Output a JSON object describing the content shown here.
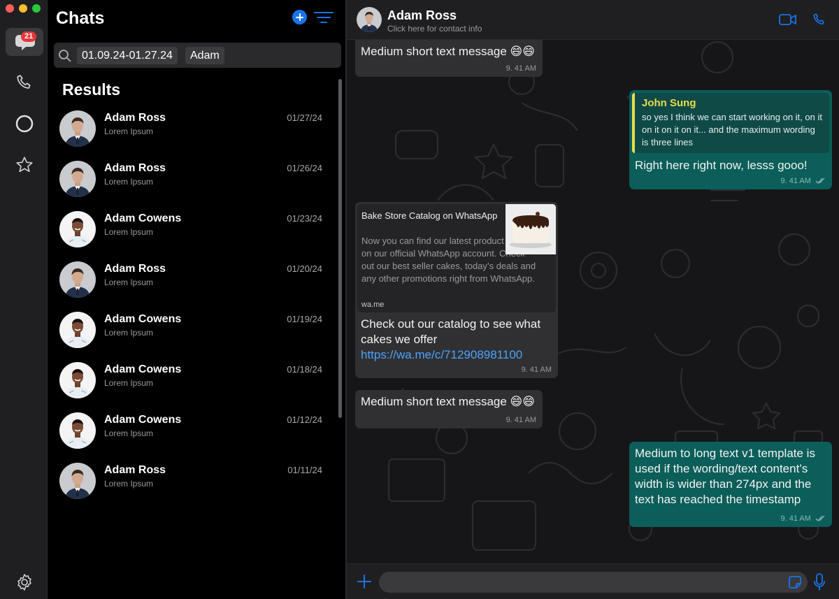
{
  "rail": {
    "chats_badge": "21"
  },
  "list": {
    "title": "Chats",
    "search_chips": [
      "01.09.24-01.27.24",
      "Adam"
    ],
    "results_title": "Results",
    "rows": [
      {
        "name": "Adam Ross",
        "preview": "Lorem Ipsum",
        "date": "01/27/24",
        "avatar": "ross"
      },
      {
        "name": "Adam Ross",
        "preview": "Lorem Ipsum",
        "date": "01/26/24",
        "avatar": "ross"
      },
      {
        "name": "Adam Cowens",
        "preview": "Lorem Ipsum",
        "date": "01/23/24",
        "avatar": "cowens"
      },
      {
        "name": "Adam Ross",
        "preview": "Lorem Ipsum",
        "date": "01/20/24",
        "avatar": "ross"
      },
      {
        "name": "Adam Cowens",
        "preview": "Lorem Ipsum",
        "date": "01/19/24",
        "avatar": "cowens"
      },
      {
        "name": "Adam Cowens",
        "preview": "Lorem Ipsum",
        "date": "01/18/24",
        "avatar": "cowens"
      },
      {
        "name": "Adam Cowens",
        "preview": "Lorem Ipsum",
        "date": "01/12/24",
        "avatar": "cowens"
      },
      {
        "name": "Adam Ross",
        "preview": "Lorem Ipsum",
        "date": "01/11/24",
        "avatar": "ross"
      }
    ]
  },
  "conversation": {
    "contact_name": "Adam Ross",
    "contact_sub": "Click here for contact info",
    "messages": {
      "m1": {
        "text": "Medium short text message 😄😄",
        "time": "9. 41 AM"
      },
      "m2": {
        "quote_author": "John Sung",
        "quote_text": "so yes I think we can start working on it, on it on it on it on it... and the maximum wording is three lines",
        "text": "Right here right now, lesss gooo!",
        "time": "9. 41 AM"
      },
      "m3": {
        "preview_title": "Bake Store Catalog on WhatsApp",
        "preview_desc": "Now you can find our latest product catalog on our official WhatsApp account. Check out our best seller cakes, today’s deals and any other promotions right from WhatsApp.",
        "preview_url": "wa.me",
        "text": "Check out our catalog to see what cakes we offer",
        "link": "https://wa.me/c/712908981100",
        "time": "9. 41 AM"
      },
      "m4": {
        "text": "Medium short text message 😄😄",
        "time": "9. 41 AM"
      },
      "m5": {
        "text": "Medium to long text v1 template is used if the wording/text content’s width is wider than 274px and the text has reached the timestamp",
        "time": "9. 41 AM"
      }
    },
    "composer_value": ""
  },
  "colors": {
    "accent": "#1a73e8",
    "outgoing_bubble": "#0b5e5a",
    "incoming_bubble": "#303032",
    "quote_author": "#e8de4b",
    "link": "#4aa3ff"
  }
}
